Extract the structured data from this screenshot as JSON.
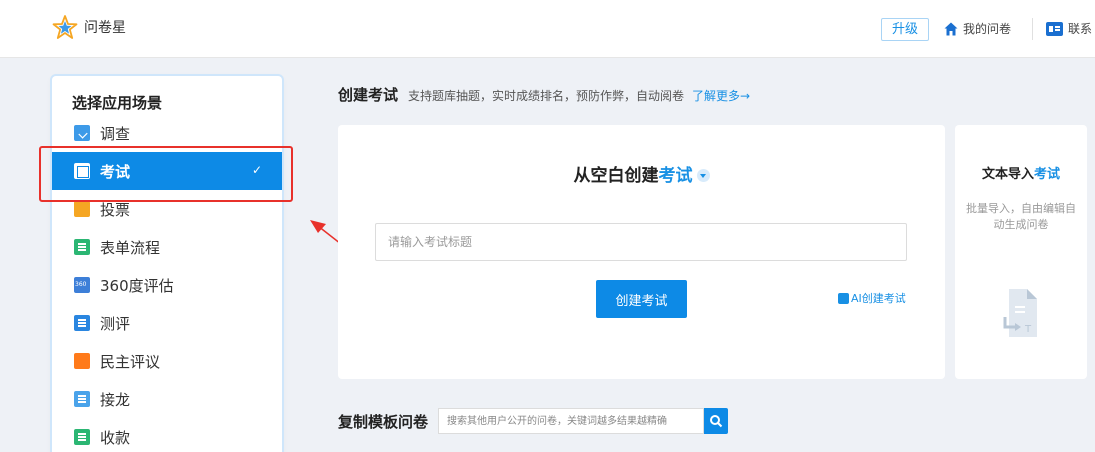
{
  "header": {
    "logo_text": "问卷星",
    "upgrade_label": "升级",
    "my_questionnaires_label": "我的问卷",
    "contact_label": "联系"
  },
  "sidebar": {
    "title": "选择应用场景",
    "items": [
      {
        "label": "调查",
        "icon": "survey-icon",
        "active": false
      },
      {
        "label": "考试",
        "icon": "exam-icon",
        "active": true
      },
      {
        "label": "投票",
        "icon": "vote-icon",
        "active": false
      },
      {
        "label": "表单流程",
        "icon": "form-flow-icon",
        "active": false
      },
      {
        "label": "360度评估",
        "icon": "360-icon",
        "active": false
      },
      {
        "label": "测评",
        "icon": "assessment-icon",
        "active": false
      },
      {
        "label": "民主评议",
        "icon": "democratic-review-icon",
        "active": false
      },
      {
        "label": "接龙",
        "icon": "relay-icon",
        "active": false
      },
      {
        "label": "收款",
        "icon": "payment-icon",
        "active": false
      }
    ],
    "check_mark": "✓"
  },
  "create_section": {
    "heading": "创建考试",
    "description": "支持题库抽题，实时成绩排名，预防作弊，自动阅卷",
    "learn_more": "了解更多→"
  },
  "blank_card": {
    "title_prefix": "从空白创建",
    "title_highlight": "考试",
    "input_placeholder": "请输入考试标题",
    "create_button": "创建考试",
    "ai_link": "AI创建考试"
  },
  "import_card": {
    "title_prefix": "文本导入",
    "title_highlight": "考试",
    "description": "批量导入，自由编辑自动生成问卷"
  },
  "copy_template": {
    "heading": "复制模板问卷",
    "search_placeholder": "搜索其他用户公开的问卷，关键词越多结果越精确"
  },
  "colors": {
    "accent": "#0d8ae6",
    "highlight_box": "#e8312b",
    "link": "#1890e4"
  }
}
